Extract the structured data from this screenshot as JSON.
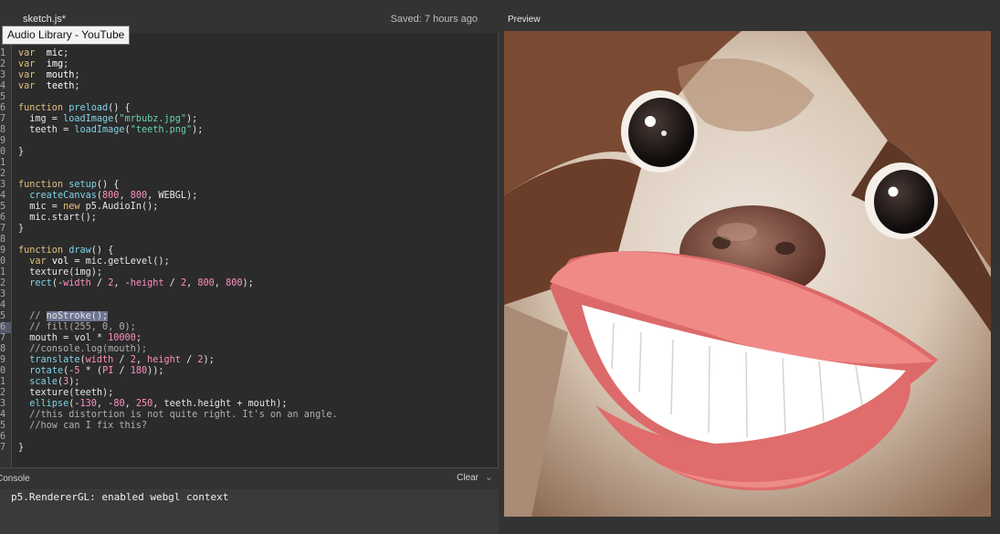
{
  "editor": {
    "file_tab": "sketch.js",
    "unsaved_marker": "*",
    "saved_status": "Saved: 7 hours ago",
    "tooltip": "Audio Library - YouTube",
    "lines": [
      {
        "n": "1",
        "parts": [
          [
            "kw",
            "var"
          ],
          [
            "",
            "  "
          ],
          [
            "var",
            "mic"
          ],
          [
            "",
            ";"
          ]
        ]
      },
      {
        "n": "2",
        "parts": [
          [
            "kw",
            "var"
          ],
          [
            "",
            "  "
          ],
          [
            "var",
            "img"
          ],
          [
            "",
            ";"
          ]
        ]
      },
      {
        "n": "3",
        "parts": [
          [
            "kw",
            "var"
          ],
          [
            "",
            "  "
          ],
          [
            "var",
            "mouth"
          ],
          [
            "",
            ";"
          ]
        ]
      },
      {
        "n": "4",
        "parts": [
          [
            "kw",
            "var"
          ],
          [
            "",
            "  "
          ],
          [
            "var",
            "teeth"
          ],
          [
            "",
            ";"
          ]
        ]
      },
      {
        "n": "5",
        "parts": []
      },
      {
        "n": "6",
        "parts": [
          [
            "kw",
            "function"
          ],
          [
            "",
            " "
          ],
          [
            "fn",
            "preload"
          ],
          [
            "",
            "() {"
          ]
        ]
      },
      {
        "n": "7",
        "parts": [
          [
            "",
            "  img = "
          ],
          [
            "fn",
            "loadImage"
          ],
          [
            "",
            "("
          ],
          [
            "str",
            "\"mrbubz.jpg\""
          ],
          [
            "",
            ");"
          ]
        ]
      },
      {
        "n": "8",
        "parts": [
          [
            "",
            "  teeth = "
          ],
          [
            "fn",
            "loadImage"
          ],
          [
            "",
            "("
          ],
          [
            "str",
            "\"teeth.png\""
          ],
          [
            "",
            ");"
          ]
        ]
      },
      {
        "n": "9",
        "parts": []
      },
      {
        "n": "0",
        "parts": [
          [
            "",
            "}"
          ]
        ]
      },
      {
        "n": "1",
        "parts": []
      },
      {
        "n": "2",
        "parts": []
      },
      {
        "n": "3",
        "parts": [
          [
            "kw",
            "function"
          ],
          [
            "",
            " "
          ],
          [
            "fn",
            "setup"
          ],
          [
            "",
            "() {"
          ]
        ]
      },
      {
        "n": "4",
        "parts": [
          [
            "",
            "  "
          ],
          [
            "fn",
            "createCanvas"
          ],
          [
            "",
            "("
          ],
          [
            "num",
            "800"
          ],
          [
            "",
            ", "
          ],
          [
            "num",
            "800"
          ],
          [
            "",
            ", WEBGL);"
          ]
        ]
      },
      {
        "n": "5",
        "parts": [
          [
            "",
            "  mic = "
          ],
          [
            "kw",
            "new"
          ],
          [
            "",
            " p5.AudioIn();"
          ]
        ]
      },
      {
        "n": "6",
        "parts": [
          [
            "",
            "  mic.start();"
          ]
        ]
      },
      {
        "n": "7",
        "parts": [
          [
            "",
            "}"
          ]
        ]
      },
      {
        "n": "8",
        "parts": []
      },
      {
        "n": "9",
        "parts": [
          [
            "kw",
            "function"
          ],
          [
            "",
            " "
          ],
          [
            "fn",
            "draw"
          ],
          [
            "",
            "() {"
          ]
        ]
      },
      {
        "n": "0",
        "parts": [
          [
            "",
            "  "
          ],
          [
            "kw",
            "var"
          ],
          [
            "",
            " "
          ],
          [
            "var",
            "vol"
          ],
          [
            "",
            " = mic.getLevel();"
          ]
        ]
      },
      {
        "n": "1",
        "parts": [
          [
            "",
            "  texture(img);"
          ]
        ]
      },
      {
        "n": "2",
        "parts": [
          [
            "",
            "  "
          ],
          [
            "fn",
            "rect"
          ],
          [
            "",
            "(-"
          ],
          [
            "const",
            "width"
          ],
          [
            "",
            " / "
          ],
          [
            "num",
            "2"
          ],
          [
            "",
            ", -"
          ],
          [
            "const",
            "height"
          ],
          [
            "",
            " / "
          ],
          [
            "num",
            "2"
          ],
          [
            "",
            ", "
          ],
          [
            "num",
            "800"
          ],
          [
            "",
            ", "
          ],
          [
            "num",
            "800"
          ],
          [
            "",
            ");"
          ]
        ]
      },
      {
        "n": "3",
        "parts": []
      },
      {
        "n": "4",
        "parts": []
      },
      {
        "n": "5",
        "parts": [
          [
            "cm",
            "  // "
          ],
          [
            "sel",
            "noStroke();"
          ]
        ]
      },
      {
        "n": "6",
        "sel": true,
        "parts": [
          [
            "cm",
            "  // fill(255, 0, 0);"
          ]
        ]
      },
      {
        "n": "7",
        "parts": [
          [
            "",
            "  mouth = vol * "
          ],
          [
            "num",
            "10000"
          ],
          [
            "",
            ";"
          ]
        ]
      },
      {
        "n": "8",
        "parts": [
          [
            "cm",
            "  //console.log(mouth);"
          ]
        ]
      },
      {
        "n": "9",
        "parts": [
          [
            "",
            "  "
          ],
          [
            "fn",
            "translate"
          ],
          [
            "",
            "("
          ],
          [
            "const",
            "width"
          ],
          [
            "",
            " / "
          ],
          [
            "num",
            "2"
          ],
          [
            "",
            ", "
          ],
          [
            "const",
            "height"
          ],
          [
            "",
            " / "
          ],
          [
            "num",
            "2"
          ],
          [
            "",
            ");"
          ]
        ]
      },
      {
        "n": "0",
        "parts": [
          [
            "",
            "  "
          ],
          [
            "fn",
            "rotate"
          ],
          [
            "",
            "(-"
          ],
          [
            "num",
            "5"
          ],
          [
            "",
            " * ("
          ],
          [
            "const",
            "PI"
          ],
          [
            "",
            " / "
          ],
          [
            "num",
            "180"
          ],
          [
            "",
            "));"
          ]
        ]
      },
      {
        "n": "1",
        "parts": [
          [
            "",
            "  "
          ],
          [
            "fn",
            "scale"
          ],
          [
            "",
            "("
          ],
          [
            "num",
            "3"
          ],
          [
            "",
            ");"
          ]
        ]
      },
      {
        "n": "2",
        "parts": [
          [
            "",
            "  texture(teeth);"
          ]
        ]
      },
      {
        "n": "3",
        "parts": [
          [
            "",
            "  "
          ],
          [
            "fn",
            "ellipse"
          ],
          [
            "",
            "(-"
          ],
          [
            "num",
            "130"
          ],
          [
            "",
            ", -"
          ],
          [
            "num",
            "80"
          ],
          [
            "",
            ", "
          ],
          [
            "num",
            "250"
          ],
          [
            "",
            ", teeth.height + mouth);"
          ]
        ]
      },
      {
        "n": "4",
        "parts": [
          [
            "cm",
            "  //this distortion is not quite right. It's on an angle."
          ]
        ]
      },
      {
        "n": "5",
        "parts": [
          [
            "cm",
            "  //how can I fix this?"
          ]
        ]
      },
      {
        "n": "6",
        "parts": []
      },
      {
        "n": "7",
        "parts": [
          [
            "",
            "}"
          ]
        ]
      }
    ]
  },
  "console": {
    "title": "Console",
    "clear_label": "Clear",
    "message": "p5.RendererGL: enabled webgl context"
  },
  "preview": {
    "label": "Preview"
  }
}
